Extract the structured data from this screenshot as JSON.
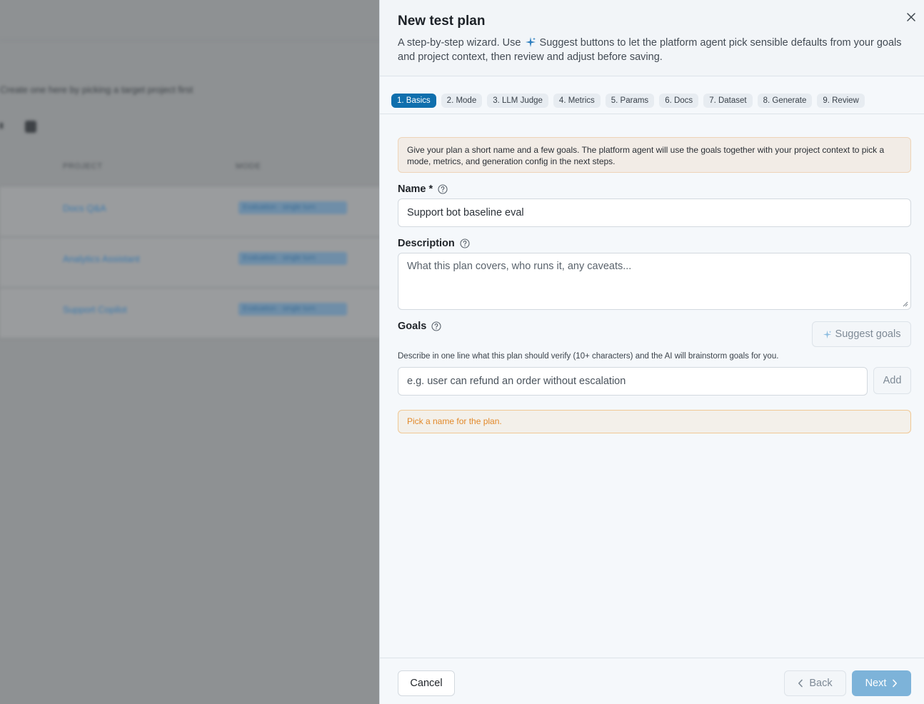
{
  "background": {
    "hint_text": "Create one here by picking a target project first",
    "columns": [
      "PROJECT",
      "MODE"
    ],
    "rows": [
      {
        "project": "Docs Q&A",
        "mode": "Evaluation · single turn"
      },
      {
        "project": "Analytics Assistant",
        "mode": "Evaluation · single turn"
      },
      {
        "project": "Support Copilot",
        "mode": "Evaluation · single turn"
      }
    ]
  },
  "drawer": {
    "title": "New test plan",
    "subtitle_before": "A step-by-step wizard. Use",
    "subtitle_after": "Suggest buttons to let the platform agent pick sensible defaults from your goals and project context, then review and adjust before saving.",
    "close_icon": "close-icon"
  },
  "steps": [
    {
      "label": "1. Basics",
      "active": true
    },
    {
      "label": "2. Mode",
      "active": false
    },
    {
      "label": "3. LLM Judge",
      "active": false
    },
    {
      "label": "4. Metrics",
      "active": false
    },
    {
      "label": "5. Params",
      "active": false
    },
    {
      "label": "6. Docs",
      "active": false
    },
    {
      "label": "7. Dataset",
      "active": false
    },
    {
      "label": "8. Generate",
      "active": false
    },
    {
      "label": "9. Review",
      "active": false
    }
  ],
  "basics": {
    "info": "Give your plan a short name and a few goals. The platform agent will use the goals together with your project context to pick a mode, metrics, and generation config in the next steps.",
    "name_label": "Name *",
    "name_value": "Support bot baseline eval",
    "description_label": "Description",
    "description_placeholder": "What this plan covers, who runs it, any caveats...",
    "goals_label": "Goals",
    "suggest_goals_label": "Suggest goals",
    "goals_help": "Describe in one line what this plan should verify (10+ characters) and the AI will brainstorm goals for you.",
    "goal_placeholder": "e.g. user can refund an order without escalation",
    "add_label": "Add",
    "warning": "Pick a name for the plan."
  },
  "footer": {
    "cancel_label": "Cancel",
    "back_label": "Back",
    "next_label": "Next"
  },
  "colors": {
    "accent": "#0f6fad",
    "next_disabled": "#7db3d9",
    "warning_text": "#e2892a",
    "warning_border": "#f0c894",
    "info_bg": "#f2ece6"
  }
}
